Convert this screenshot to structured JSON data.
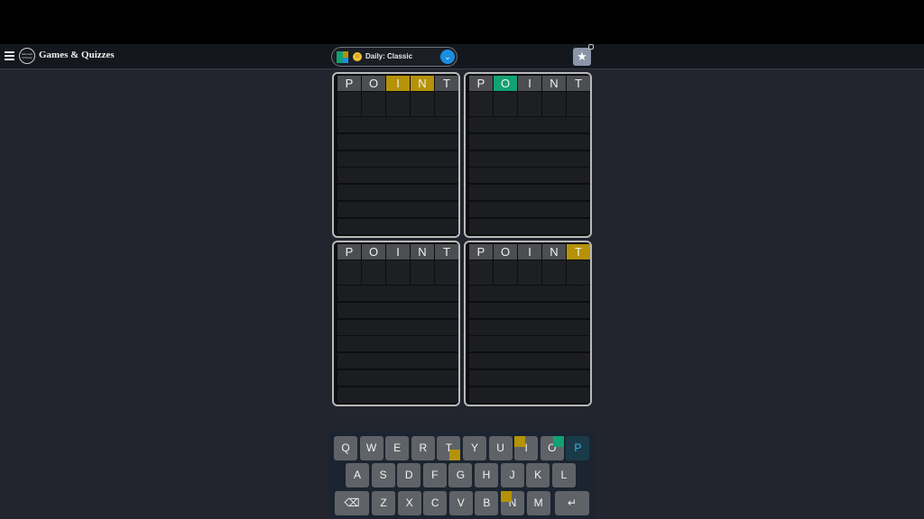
{
  "header": {
    "brand": "Games & Quizzes",
    "logo_text": "Merriam Webster",
    "mode_label": "Daily: Classic",
    "mode_flag_colors": [
      "#11a172",
      "#b59208",
      "#11a172",
      "#1a8ee0"
    ],
    "accent": "#1a8ee0"
  },
  "boards": [
    {
      "guess": [
        "P",
        "O",
        "I",
        "N",
        "T"
      ],
      "states": [
        "n",
        "n",
        "y",
        "y",
        "n"
      ]
    },
    {
      "guess": [
        "P",
        "O",
        "I",
        "N",
        "T"
      ],
      "states": [
        "n",
        "g",
        "n",
        "n",
        "n"
      ]
    },
    {
      "guess": [
        "P",
        "O",
        "I",
        "N",
        "T"
      ],
      "states": [
        "n",
        "n",
        "n",
        "n",
        "n"
      ]
    },
    {
      "guess": [
        "P",
        "O",
        "I",
        "N",
        "T"
      ],
      "states": [
        "n",
        "n",
        "n",
        "n",
        "y"
      ]
    }
  ],
  "colors": {
    "yellow": "#b59208",
    "green": "#11a172",
    "gray": "#4c4e52"
  },
  "keyboard": {
    "row1": [
      "Q",
      "W",
      "E",
      "R",
      "T",
      "Y",
      "U",
      "I",
      "O",
      "P"
    ],
    "row2": [
      "A",
      "S",
      "D",
      "F",
      "G",
      "H",
      "J",
      "K",
      "L"
    ],
    "row3": [
      "Z",
      "X",
      "C",
      "V",
      "B",
      "N",
      "M"
    ],
    "backspace": "⌫",
    "enter": "↵"
  }
}
